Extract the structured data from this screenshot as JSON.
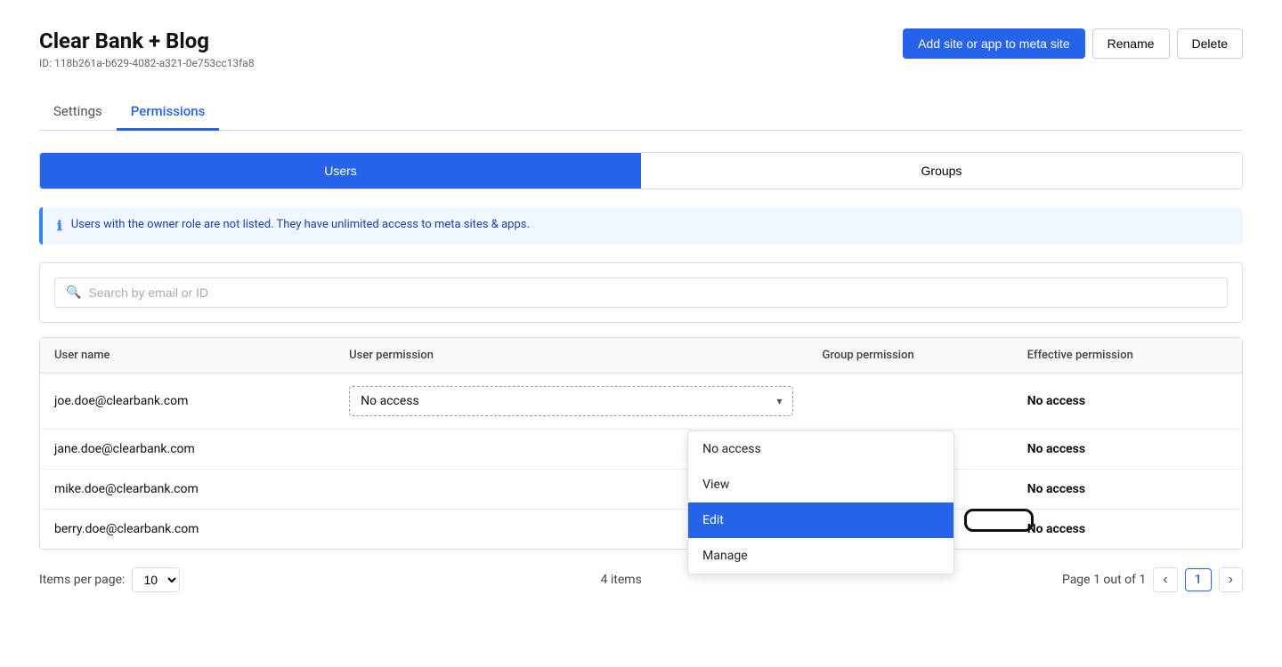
{
  "header": {
    "title": "Clear Bank + Blog",
    "site_id": "ID: 118b261a-b629-4082-a321-0e753cc13fa8",
    "btn_add": "Add site or app to meta site",
    "btn_rename": "Rename",
    "btn_delete": "Delete"
  },
  "tabs": [
    {
      "label": "Settings",
      "active": false
    },
    {
      "label": "Permissions",
      "active": true
    }
  ],
  "toggle": {
    "users_label": "Users",
    "groups_label": "Groups"
  },
  "info_banner": {
    "text": "Users with the owner role are not listed. They have unlimited access to meta sites & apps."
  },
  "search": {
    "placeholder": "Search by email or ID"
  },
  "table": {
    "columns": [
      "User name",
      "User permission",
      "Group permission",
      "Effective permission"
    ],
    "rows": [
      {
        "username": "joe.doe@clearbank.com",
        "user_permission": "No access",
        "group_permission": "",
        "effective_permission": "No access",
        "has_dropdown": true
      },
      {
        "username": "jane.doe@clearbank.com",
        "user_permission": "",
        "group_permission": "",
        "effective_permission": "No access",
        "has_dropdown": false
      },
      {
        "username": "mike.doe@clearbank.com",
        "user_permission": "",
        "group_permission": "",
        "effective_permission": "No access",
        "has_dropdown": false
      },
      {
        "username": "berry.doe@clearbank.com",
        "user_permission": "",
        "group_permission": "",
        "effective_permission": "No access",
        "has_dropdown": false
      }
    ],
    "dropdown_options": [
      "No access",
      "View",
      "Edit",
      "Manage"
    ],
    "dropdown_selected": "Edit",
    "dropdown_current": "No access"
  },
  "pagination": {
    "items_per_page_label": "Items per page:",
    "items_per_page_value": "10",
    "total_items": "4 items",
    "page_info": "Page 1 out of 1",
    "current_page": "1"
  }
}
